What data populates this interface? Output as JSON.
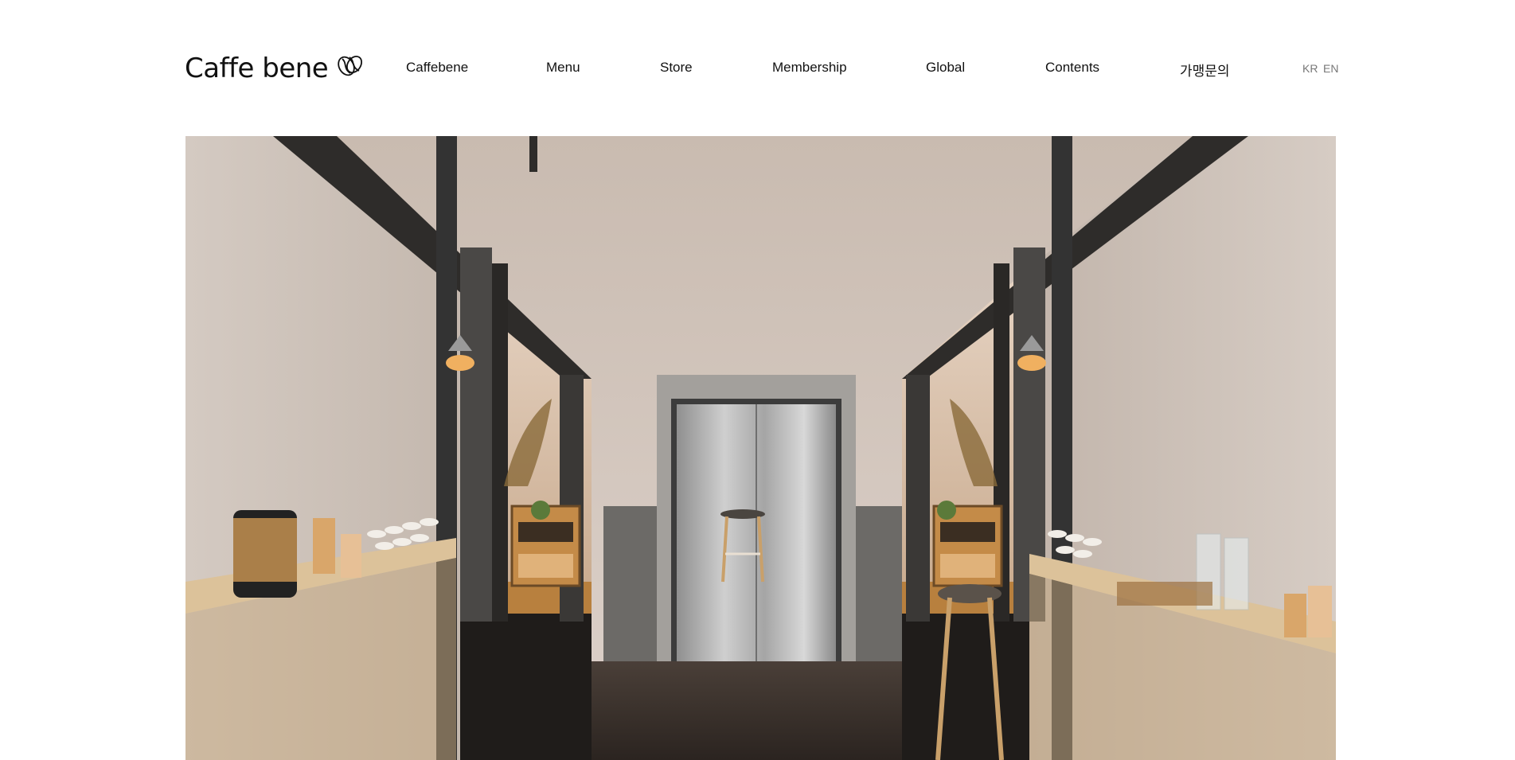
{
  "brand": {
    "name": "Caffe bene",
    "icon": "coffee-bean-icon"
  },
  "nav": {
    "items": [
      {
        "label": "Caffebene"
      },
      {
        "label": "Menu"
      },
      {
        "label": "Store"
      },
      {
        "label": "Membership"
      },
      {
        "label": "Global"
      },
      {
        "label": "Contents"
      },
      {
        "label": "가맹문의"
      }
    ]
  },
  "lang": {
    "kr": "KR",
    "en": "EN"
  },
  "colors": {
    "text": "#111111",
    "lang_text": "#777777",
    "background": "#ffffff"
  }
}
